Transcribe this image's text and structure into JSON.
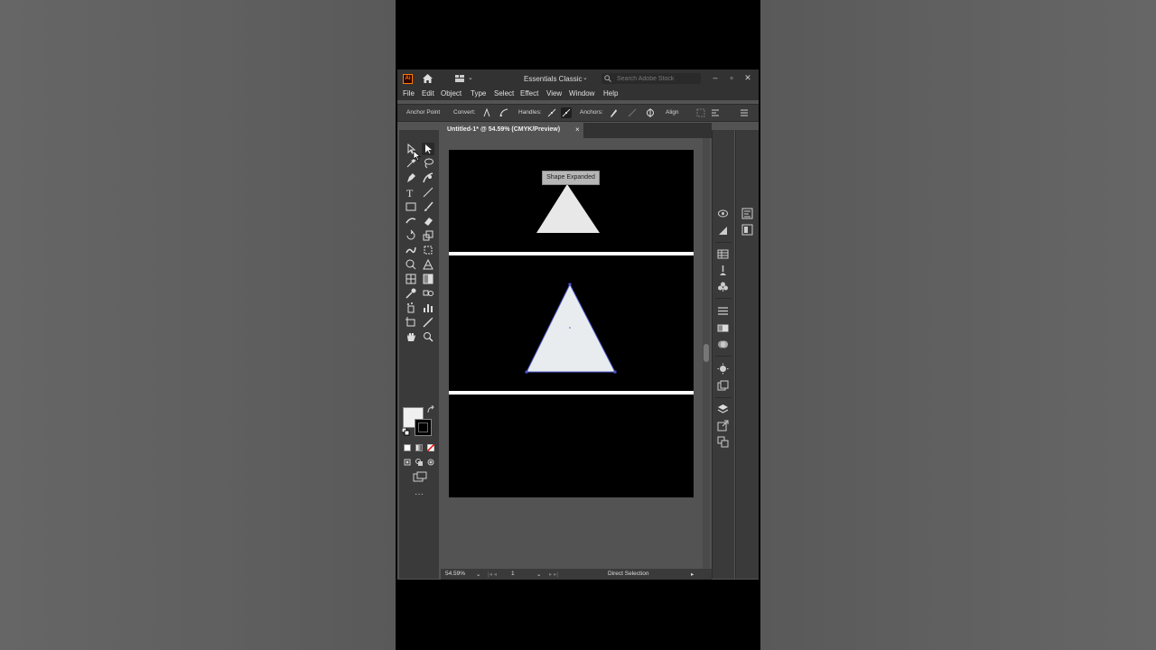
{
  "app": {
    "logo_text": "Ai",
    "workspace_label": "Essentials Classic",
    "search_placeholder": "Search Adobe Stock"
  },
  "menu": [
    "File",
    "Edit",
    "Object",
    "Type",
    "Select",
    "Effect",
    "View",
    "Window",
    "Help"
  ],
  "control_bar": {
    "anchor_point_label": "Anchor Point",
    "convert_label": "Convert:",
    "handles_label": "Handles:",
    "anchors_label": "Anchors:",
    "align_label": "Align"
  },
  "document": {
    "tab_title": "Untitled-1* @ 54.59% (CMYK/Preview)",
    "close_glyph": "×"
  },
  "canvas": {
    "tooltip": "Shape Expanded"
  },
  "status": {
    "zoom": "54.59%",
    "artboard_number": "1",
    "tool_name": "Direct Selection"
  },
  "colors": {
    "fill": "#f0f0f0",
    "stroke": "#000000",
    "selection": "#4a55c8"
  }
}
